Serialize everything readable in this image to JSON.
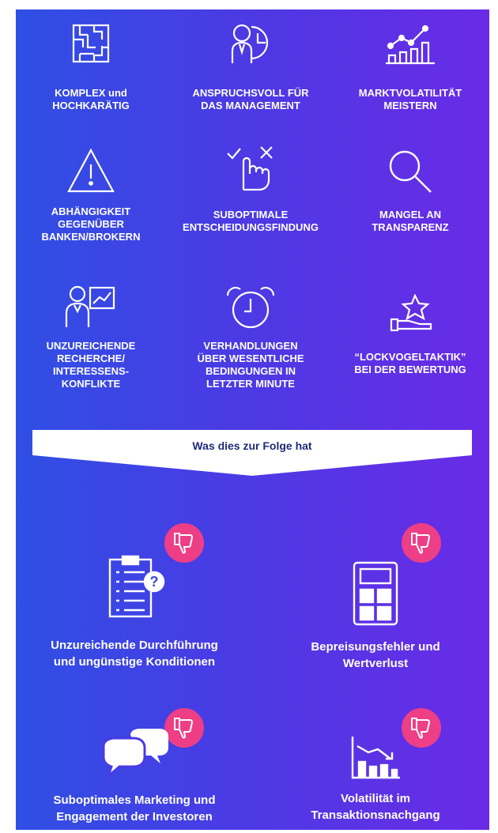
{
  "problems": [
    {
      "icon": "maze-icon",
      "lines": [
        "KOMPLEX und",
        "HOCHKARÄTIG"
      ]
    },
    {
      "icon": "manager-clock-icon",
      "lines": [
        "ANSPRUCHSVOLL FÜR",
        "DAS MANAGEMENT"
      ]
    },
    {
      "icon": "market-chart-icon",
      "lines": [
        "MARKTVOLATILITÄT",
        "MEISTERN"
      ]
    },
    {
      "icon": "warning-icon",
      "lines": [
        "ABHÄNGIGKEIT",
        "GEGENÜBER",
        "BANKEN/BROKERN"
      ]
    },
    {
      "icon": "decision-hand-icon",
      "lines": [
        "SUBOPTIMALE",
        "ENTSCHEIDUNGSFINDUNG"
      ]
    },
    {
      "icon": "magnifier-icon",
      "lines": [
        "MANGEL AN",
        "TRANSPARENZ"
      ]
    },
    {
      "icon": "presenter-icon",
      "lines": [
        "UNZUREICHENDE",
        "RECHERCHE/",
        "INTERESSENS-",
        "KONFLIKTE"
      ]
    },
    {
      "icon": "alarm-clock-icon",
      "lines": [
        "VERHANDLUNGEN",
        "ÜBER WESENTLICHE",
        "BEDINGUNGEN IN",
        "LETZTER MINUTE"
      ]
    },
    {
      "icon": "star-hand-icon",
      "lines": [
        "“LOCKVOGELTAKTIK”",
        "BEI DER BEWERTUNG"
      ]
    }
  ],
  "banner": {
    "text": "Was dies zur Folge hat"
  },
  "consequences": [
    {
      "icon": "clipboard-question-icon",
      "lines": [
        "Unzureichende Durchführung",
        "und ungünstige Konditionen"
      ]
    },
    {
      "icon": "calculator-icon",
      "lines": [
        "Bepreisungsfehler und",
        "Wertverlust"
      ]
    },
    {
      "icon": "speech-bubbles-icon",
      "lines": [
        "Suboptimales Marketing und",
        "Engagement der Investoren"
      ]
    },
    {
      "icon": "declining-chart-icon",
      "lines": [
        "Volatilität im",
        "Transaktionsnachgang"
      ]
    }
  ],
  "colors": {
    "gradient_start": "#2f4fe4",
    "gradient_end": "#6a2be6",
    "thumb_badge": "#ee3e86",
    "banner_text": "#1e2a78"
  }
}
